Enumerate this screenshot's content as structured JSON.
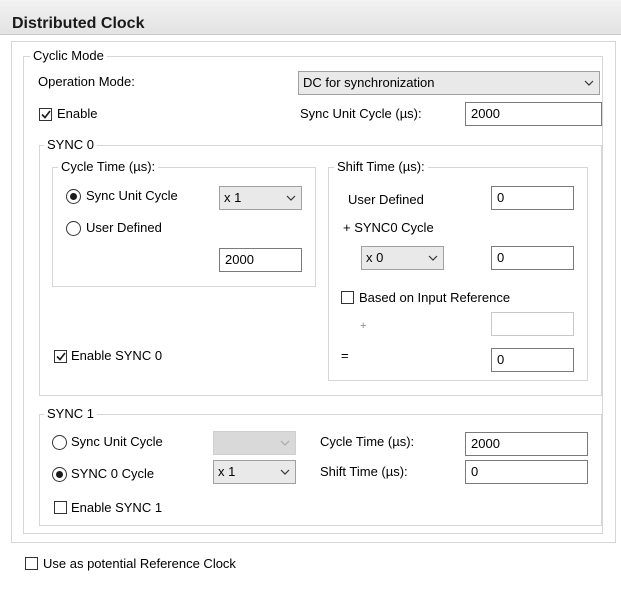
{
  "header": {
    "title": "Distributed Clock"
  },
  "cyclic_mode": {
    "legend": "Cyclic Mode",
    "operation_mode_label": "Operation Mode:",
    "operation_mode_value": "DC for synchronization",
    "enable_label": "Enable",
    "enable_checked": true,
    "sync_unit_cycle_label": "Sync Unit Cycle (µs):",
    "sync_unit_cycle_value": "2000"
  },
  "sync0": {
    "legend": "SYNC 0",
    "cycle_time": {
      "legend": "Cycle Time (µs):",
      "sync_unit_cycle_label": "Sync Unit Cycle",
      "multiplier": "x 1",
      "user_defined_label": "User Defined",
      "value": "2000",
      "selected": "sync_unit_cycle"
    },
    "shift_time": {
      "legend": "Shift Time (µs):",
      "user_defined_label": "User Defined",
      "user_defined_value": "0",
      "plus_sync0_label": "+ SYNC0 Cycle",
      "multiplier": "x 0",
      "multiplier_value": "0",
      "based_on_input_label": "Based on Input Reference",
      "based_on_input_checked": false,
      "plus_sign": "+",
      "plus_value": "",
      "equals_sign": "=",
      "result_value": "0"
    },
    "enable_label": "Enable SYNC 0",
    "enable_checked": true
  },
  "sync1": {
    "legend": "SYNC 1",
    "sync_unit_cycle_label": "Sync Unit Cycle",
    "sync_unit_multiplier": "",
    "sync0_cycle_label": "SYNC 0 Cycle",
    "sync0_multiplier": "x 1",
    "selected": "sync0_cycle",
    "cycle_time_label": "Cycle Time (µs):",
    "cycle_time_value": "2000",
    "shift_time_label": "Shift Time (µs):",
    "shift_time_value": "0",
    "enable_label": "Enable SYNC 1",
    "enable_checked": false
  },
  "reference_clock": {
    "label": "Use as potential Reference Clock",
    "checked": false
  },
  "icons": {
    "check": "check-icon",
    "dropdown": "chevron-down-icon"
  }
}
